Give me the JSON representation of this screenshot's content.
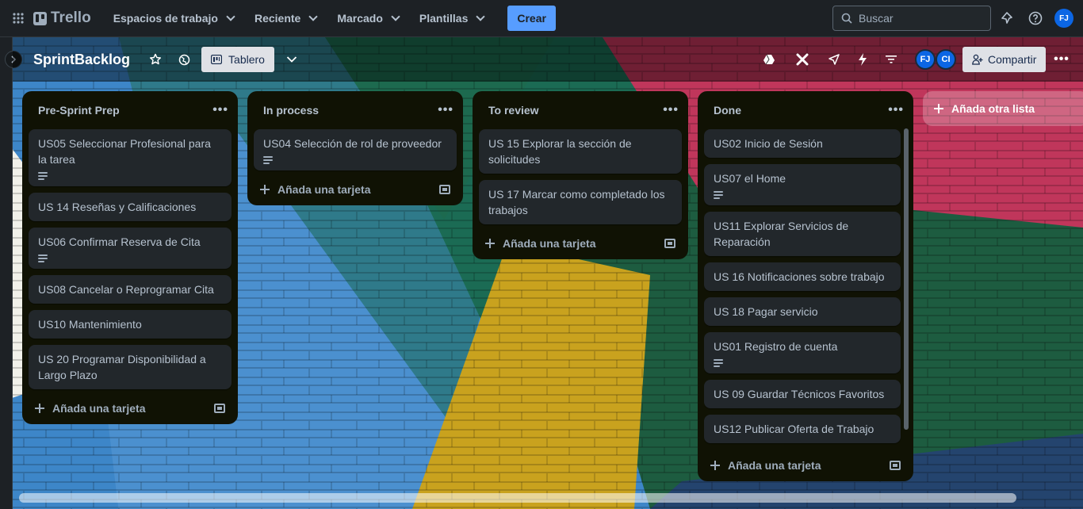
{
  "topbar": {
    "logo": "Trello",
    "nav": [
      "Espacios de trabajo",
      "Reciente",
      "Marcado",
      "Plantillas"
    ],
    "create": "Crear",
    "search_placeholder": "Buscar",
    "user_initials": "FJ"
  },
  "board": {
    "title": "SprintBacklog",
    "view": "Tablero",
    "share": "Compartir",
    "members": [
      "FJ",
      "CI"
    ],
    "add_list": "Añada otra lista"
  },
  "lists": [
    {
      "title": "Pre-Sprint Prep",
      "cards": [
        {
          "title": "US05 Seleccionar Profesional para la tarea",
          "has_description": true
        },
        {
          "title": "US 14 Reseñas y Calificaciones",
          "has_description": false
        },
        {
          "title": "US06 Confirmar Reserva de Cita",
          "has_description": true
        },
        {
          "title": "US08 Cancelar o Reprogramar Cita",
          "has_description": false
        },
        {
          "title": "US10 Mantenimiento",
          "has_description": false
        },
        {
          "title": "US 20 Programar Disponibilidad a Largo Plazo",
          "has_description": false
        }
      ],
      "add_card": "Añada una tarjeta"
    },
    {
      "title": "In process",
      "cards": [
        {
          "title": "US04 Selección de rol de proveedor",
          "has_description": true
        }
      ],
      "add_card": "Añada una tarjeta"
    },
    {
      "title": "To review",
      "cards": [
        {
          "title": "US 15 Explorar la sección de solicitudes",
          "has_description": false
        },
        {
          "title": "US 17 Marcar como completado los trabajos",
          "has_description": false
        }
      ],
      "add_card": "Añada una tarjeta"
    },
    {
      "title": "Done",
      "cards": [
        {
          "title": "US02 Inicio de Sesión",
          "has_description": false
        },
        {
          "title": "US07 el Home",
          "has_description": true
        },
        {
          "title": "US11 Explorar Servicios de Reparación",
          "has_description": false
        },
        {
          "title": "US 16 Notificaciones sobre trabajo",
          "has_description": false
        },
        {
          "title": "US 18 Pagar servicio",
          "has_description": false
        },
        {
          "title": "US01 Registro de cuenta",
          "has_description": true
        },
        {
          "title": "US 09 Guardar Técnicos Favoritos",
          "has_description": false
        },
        {
          "title": "US12 Publicar Oferta de Trabajo",
          "has_description": false
        }
      ],
      "add_card": "Añada una tarjeta"
    }
  ],
  "colors": {
    "accent": "#579dff",
    "list_bg": "#101204",
    "card_bg": "#22272b"
  }
}
